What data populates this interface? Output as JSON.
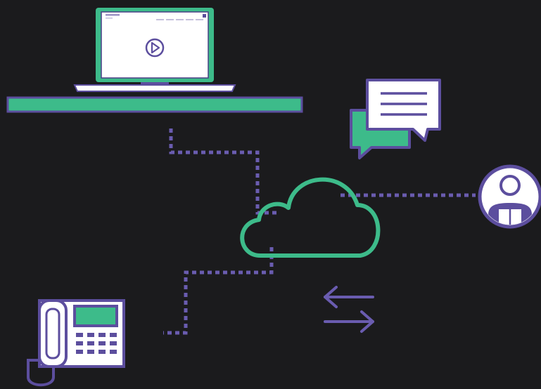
{
  "colors": {
    "background": "#1b1b1d",
    "green": "#3dbb8a",
    "purple": "#5c4e9e",
    "connector": "#6a5cb0",
    "white": "#ffffff",
    "light_gray": "#dcdce4",
    "dark_outline": "#4a3f86"
  },
  "icons": {
    "laptop": "laptop-icon",
    "video": "play-icon",
    "chat": "chat-bubbles-icon",
    "cloud": "cloud-icon",
    "user": "user-icon",
    "phone": "desk-phone-icon",
    "sync": "bidirectional-arrows-icon"
  },
  "nodes": [
    {
      "id": "laptop",
      "name": "laptop"
    },
    {
      "id": "chat",
      "name": "chat"
    },
    {
      "id": "cloud",
      "name": "cloud"
    },
    {
      "id": "user",
      "name": "user"
    },
    {
      "id": "phone",
      "name": "phone"
    }
  ],
  "edges": [
    {
      "from": "laptop",
      "to": "cloud",
      "style": "dotted"
    },
    {
      "from": "cloud",
      "to": "user",
      "style": "dotted"
    },
    {
      "from": "cloud",
      "to": "phone",
      "style": "dotted"
    }
  ]
}
